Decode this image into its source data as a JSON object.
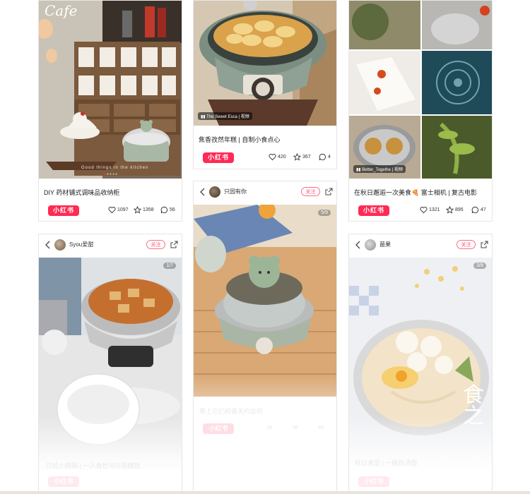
{
  "app": {
    "logo_text": "小红书",
    "follow_label": "关注"
  },
  "card1": {
    "caption": "DIY 药材铺式调味品收纳柜",
    "likes": "1097",
    "stars": "1358",
    "comments": "56",
    "photo_text": "Cafe",
    "subtitle": "Good things in the kitchen"
  },
  "card2": {
    "caption": "焦香孜然年糕 | 自制小食点心",
    "likes": "420",
    "stars": "367",
    "comments": "4",
    "badge": "The Sweet Esca",
    "badge_tag": "视频"
  },
  "card3": {
    "caption": "在秋日邂逅一次美食🍕 富士相机 | 复古电影",
    "likes": "1321",
    "stars": "895",
    "comments": "47",
    "badge": "Better_Togethe",
    "badge_tag": "视频"
  },
  "card4": {
    "username": "Syou爱甜",
    "pager": "1/7",
    "ghost_caption": "日式小炖锅 | 一人食也可以很精致"
  },
  "card5": {
    "username": "只园有你",
    "pager": "5/9",
    "ghost_caption": "带上它们和春天约会吧",
    "ghost_likes": "56",
    "ghost_stars": "58",
    "ghost_comments": "46"
  },
  "card6": {
    "username": "菌果",
    "pager": "3/8",
    "ghost_caption": "秋日食堂 | 一碗热汤面",
    "overlay_text": "食之"
  },
  "colors": {
    "brand": "#ff2a55",
    "follow": "#ff4d6d"
  }
}
